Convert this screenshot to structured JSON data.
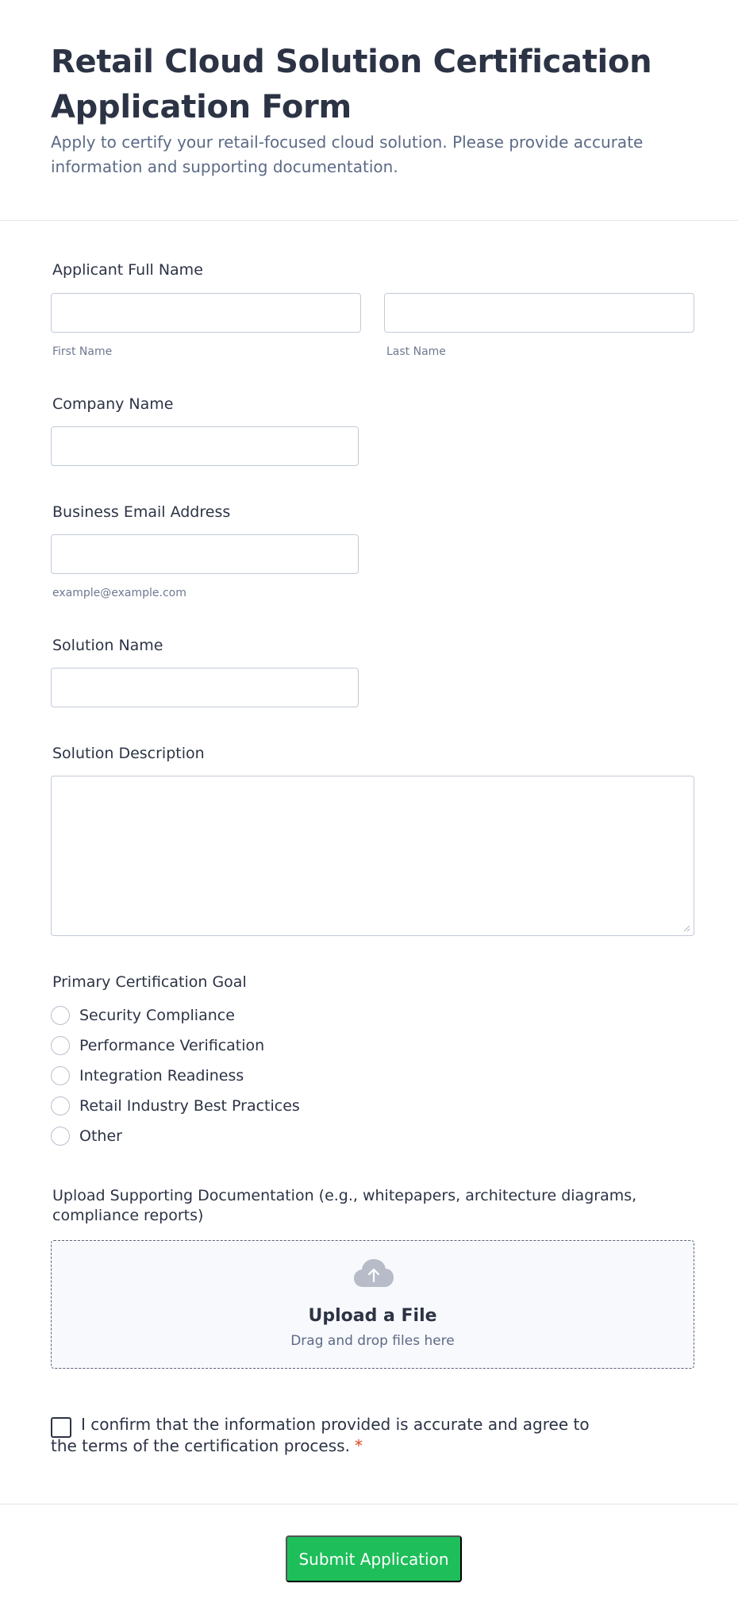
{
  "form": {
    "title": "Retail Cloud Solution Certification Application Form",
    "subtitle": "Apply to certify your retail-focused cloud solution. Please provide accurate information and supporting documentation."
  },
  "fields": {
    "applicant_name": {
      "label": "Applicant Full Name",
      "first_sublabel": "First Name",
      "last_sublabel": "Last Name",
      "first_value": "",
      "last_value": ""
    },
    "company": {
      "label": "Company Name",
      "value": ""
    },
    "email": {
      "label": "Business Email Address",
      "sublabel": "example@example.com",
      "value": ""
    },
    "solution_name": {
      "label": "Solution Name",
      "value": ""
    },
    "solution_description": {
      "label": "Solution Description",
      "value": ""
    }
  },
  "goal": {
    "label": "Primary Certification Goal",
    "options": [
      "Security Compliance",
      "Performance Verification",
      "Integration Readiness",
      "Retail Industry Best Practices",
      "Other"
    ]
  },
  "upload": {
    "label": "Upload Supporting Documentation (e.g., whitepapers, architecture diagrams, compliance reports)",
    "title": "Upload a File",
    "subtitle": "Drag and drop files here",
    "icon": "cloud-upload-icon"
  },
  "consent": {
    "text": "I confirm that the information provided is accurate and agree to the terms of the certification process.",
    "required_mark": "*",
    "checked": false
  },
  "submit": {
    "label": "Submit Application"
  },
  "colors": {
    "accent": "#1ebe5a",
    "text": "#2c3345",
    "muted": "#5c6a86",
    "border": "#c3cad8",
    "required": "#e3401c"
  }
}
